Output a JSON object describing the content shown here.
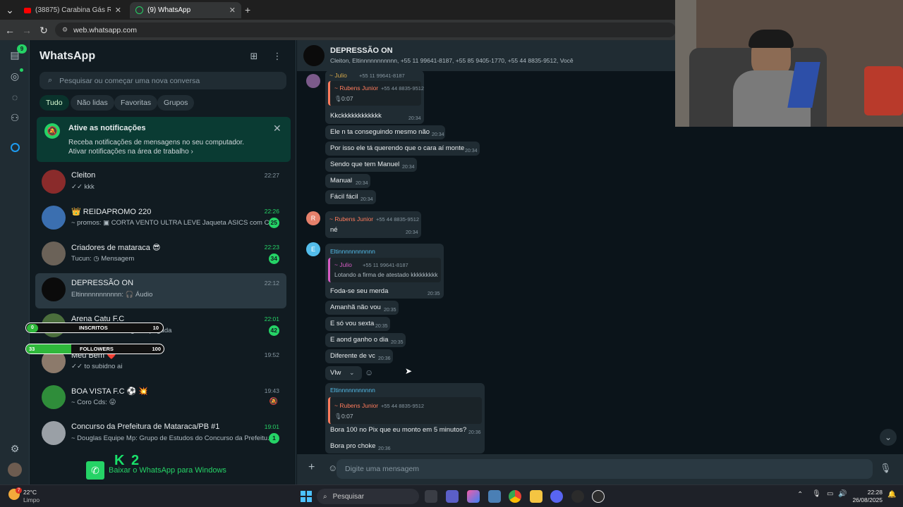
{
  "browser": {
    "tabs": [
      {
        "title": "(38875) Carabina Gás Ram Mai...",
        "active": false
      },
      {
        "title": "(9) WhatsApp",
        "active": true
      }
    ],
    "url": "web.whatsapp.com"
  },
  "rail": {
    "chats_badge": "9"
  },
  "sidebar": {
    "app_title": "WhatsApp",
    "search_placeholder": "Pesquisar ou começar uma nova conversa",
    "filters": [
      "Tudo",
      "Não lidas",
      "Favoritas",
      "Grupos"
    ],
    "notification": {
      "title": "Ative as notificações",
      "body": "Receba notificações de mensagens no seu computador.",
      "link": "Ativar notificações na área de trabalho ›"
    },
    "chats": [
      {
        "name": "Cleiton",
        "preview": "✓✓ kkk",
        "time": "22:27",
        "unread": ""
      },
      {
        "name": "👑 REIDAPROMO 220",
        "preview": "~ promos: ▣ CORTA VENTO ULTRA LEVE Jaqueta ASICS com Ca...",
        "time": "22:26",
        "unread": "25"
      },
      {
        "name": "Criadores de mataraca 😎",
        "preview": "Tucun: ◷ Mensagem",
        "time": "22:23",
        "unread": "34"
      },
      {
        "name": "DEPRESSÃO ON",
        "preview": "Eltinnnnnnnnnnn: 🎧 Áudio",
        "time": "22:12",
        "unread": ""
      },
      {
        "name": "Arena Catu F.C",
        "preview": "~ Andson: ⊘ Mensagem apagada",
        "time": "22:01",
        "unread": "42"
      },
      {
        "name": "Meu Bem ❤️",
        "preview": "✓✓ to subidno ai",
        "time": "19:52",
        "unread": ""
      },
      {
        "name": "BOA VISTA F.C ⚽ 💥",
        "preview": "~ Coro Cds: 😜",
        "time": "19:43",
        "unread": ""
      },
      {
        "name": "Concurso da Prefeitura de Mataraca/PB #1",
        "preview": "~ Douglas Equipe Mp: Grupo de Estudos do Concurso da Prefeitu...",
        "time": "19:01",
        "unread": "1"
      }
    ],
    "download_banner": "Baixar o WhatsApp para Windows"
  },
  "overlay": {
    "inscritos": {
      "count": "0",
      "label": "INSCRITOS",
      "goal": "10"
    },
    "followers": {
      "count": "33",
      "label": "FOLLOWERS",
      "goal": "100"
    },
    "logo": "K 2"
  },
  "chat": {
    "group_name": "DEPRESSÃO ON",
    "members": "Cleiton, Eltinnnnnnnnnnn, +55 11 99641-8187, +55 85 9405-1770, +55 44 8835-9512, Você",
    "messages": {
      "m1_sender": "~ Julio",
      "m1_number": "+55 11 99641-8187",
      "m1_quote_sender": "~ Rubens Junior",
      "m1_quote_number": "+55 44 8835-9512",
      "m1_quote_audio": "0:07",
      "m1_text": "Kkckkkkkkkkkkkk",
      "m1_time": "20:34",
      "m2_text": "Ele n ta conseguindo mesmo não",
      "m2_time": "20:34",
      "m3_text": "Por isso ele tá querendo que o cara aí monte",
      "m3_time": "20:34",
      "m4_text": "Sendo que tem Manuel",
      "m4_time": "20:34",
      "m5_text": "Manual",
      "m5_time": "20:34",
      "m6_text": "Fácil fácil",
      "m6_time": "20:34",
      "m7_avatar": "R",
      "m7_sender": "~ Rubens Junior",
      "m7_number": "+55 44 8835-9512",
      "m7_text": "né",
      "m7_time": "20:34",
      "m8_avatar": "E",
      "m8_sender": "Eltinnnnnnnnnnn",
      "m8_quote_sender": "~ Julio",
      "m8_quote_number": "+55 11 99641-8187",
      "m8_quote_text": "Lotando a firma de atestado kkkkkkkkk",
      "m8_text": "Foda-se seu merda",
      "m8_time": "20:35",
      "m9_text": "Amanhã não vou",
      "m9_time": "20:35",
      "m10_text": "E só vou sexta",
      "m10_time": "20:35",
      "m11_text": "E aond ganho o dia",
      "m11_time": "20:35",
      "m12_text": "Diferente de vc",
      "m12_time": "20:36",
      "m13_text": "Vlw",
      "m14_sender": "Eltinnnnnnnnnnn",
      "m14_quote_sender": "~ Rubens Junior",
      "m14_quote_number": "+55 44 8835-9512",
      "m14_quote_audio": "0:07",
      "m14_text": "Bora 100 no Pix que eu monto em 5 minutos?",
      "m14_time": "20:36",
      "m15_text": "Bora pro choke",
      "m15_time": "20:36"
    },
    "input_placeholder": "Digite uma mensagem"
  },
  "taskbar": {
    "weather_temp": "22°C",
    "weather_text": "Limpo",
    "weather_badge": "7",
    "search_label": "Pesquisar",
    "time": "22:28",
    "date": "26/08/2025"
  },
  "colors": {
    "accent": "#25d366",
    "panel": "#202c33",
    "bg": "#0b141a"
  }
}
